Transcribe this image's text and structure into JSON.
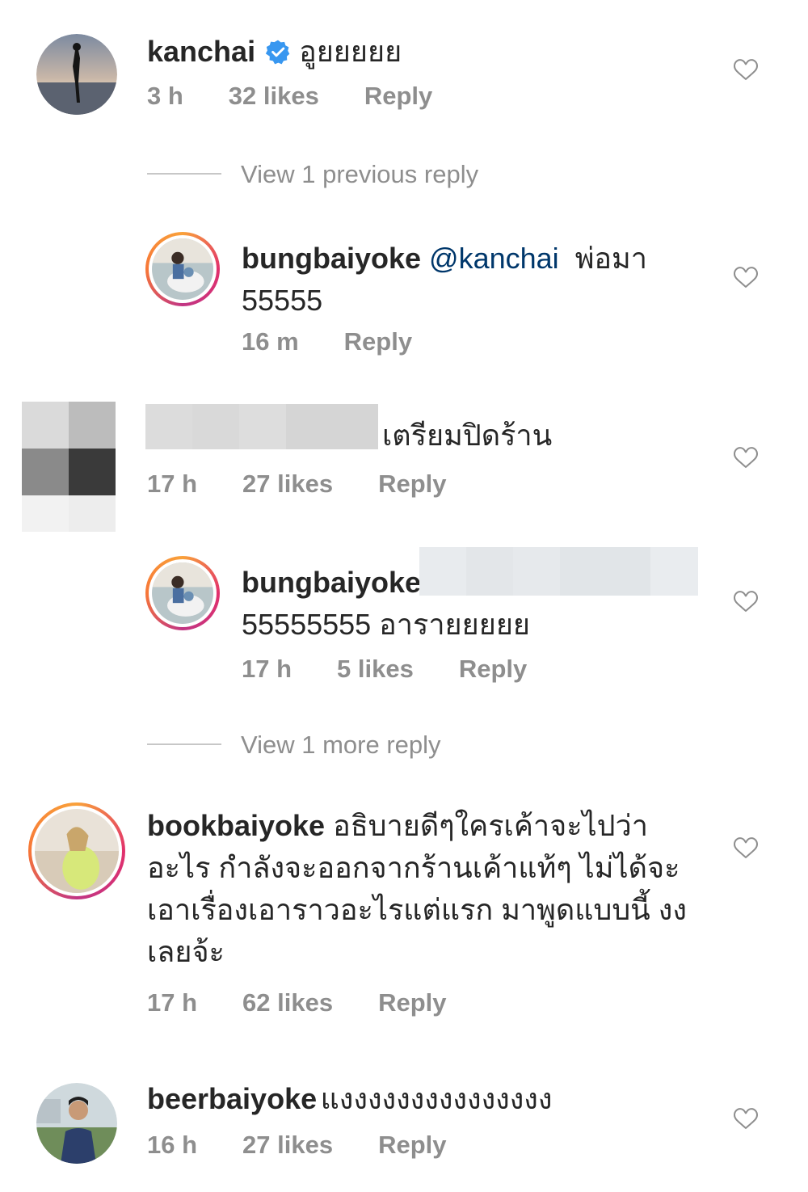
{
  "comments": [
    {
      "username": "kanchai",
      "verified": true,
      "text": "อูยยยยย",
      "time": "3 h",
      "likes": "32 likes",
      "reply": "Reply"
    },
    {
      "view_replies": "View 1 previous reply"
    },
    {
      "username": "bungbaiyoke",
      "mention": "@kanchai",
      "text_line1": "พ่อมา",
      "text_line2": "55555",
      "time": "16 m",
      "reply": "Reply"
    },
    {
      "text": "เตรียมปิดร้าน",
      "time": "17 h",
      "likes": "27 likes",
      "reply": "Reply"
    },
    {
      "username": "bungbaiyoke",
      "text": "55555555 อารายยยยย",
      "time": "17 h",
      "likes": "5 likes",
      "reply": "Reply"
    },
    {
      "view_replies": "View 1 more reply"
    },
    {
      "username": "bookbaiyoke",
      "lines": [
        "อธิบายดีๆใครเค้าจะไปว่า",
        "อะไร กำลังจะออกจากร้านเค้าแท้ๆ ไม่ได้จะ",
        "เอาเรื่องเอาราวอะไรแต่แรก มาพูดแบบนี้ งง",
        "เลยจ้ะ"
      ],
      "time": "17 h",
      "likes": "62 likes",
      "reply": "Reply"
    },
    {
      "username": "beerbaiyoke",
      "text": "แงงงงงงงงงงงงงงง",
      "time": "16 h",
      "likes": "27 likes",
      "reply": "Reply"
    }
  ],
  "colors": {
    "text": "#262626",
    "meta": "#8e8e8e",
    "mention": "#00376b",
    "verified": "#3897f0"
  }
}
